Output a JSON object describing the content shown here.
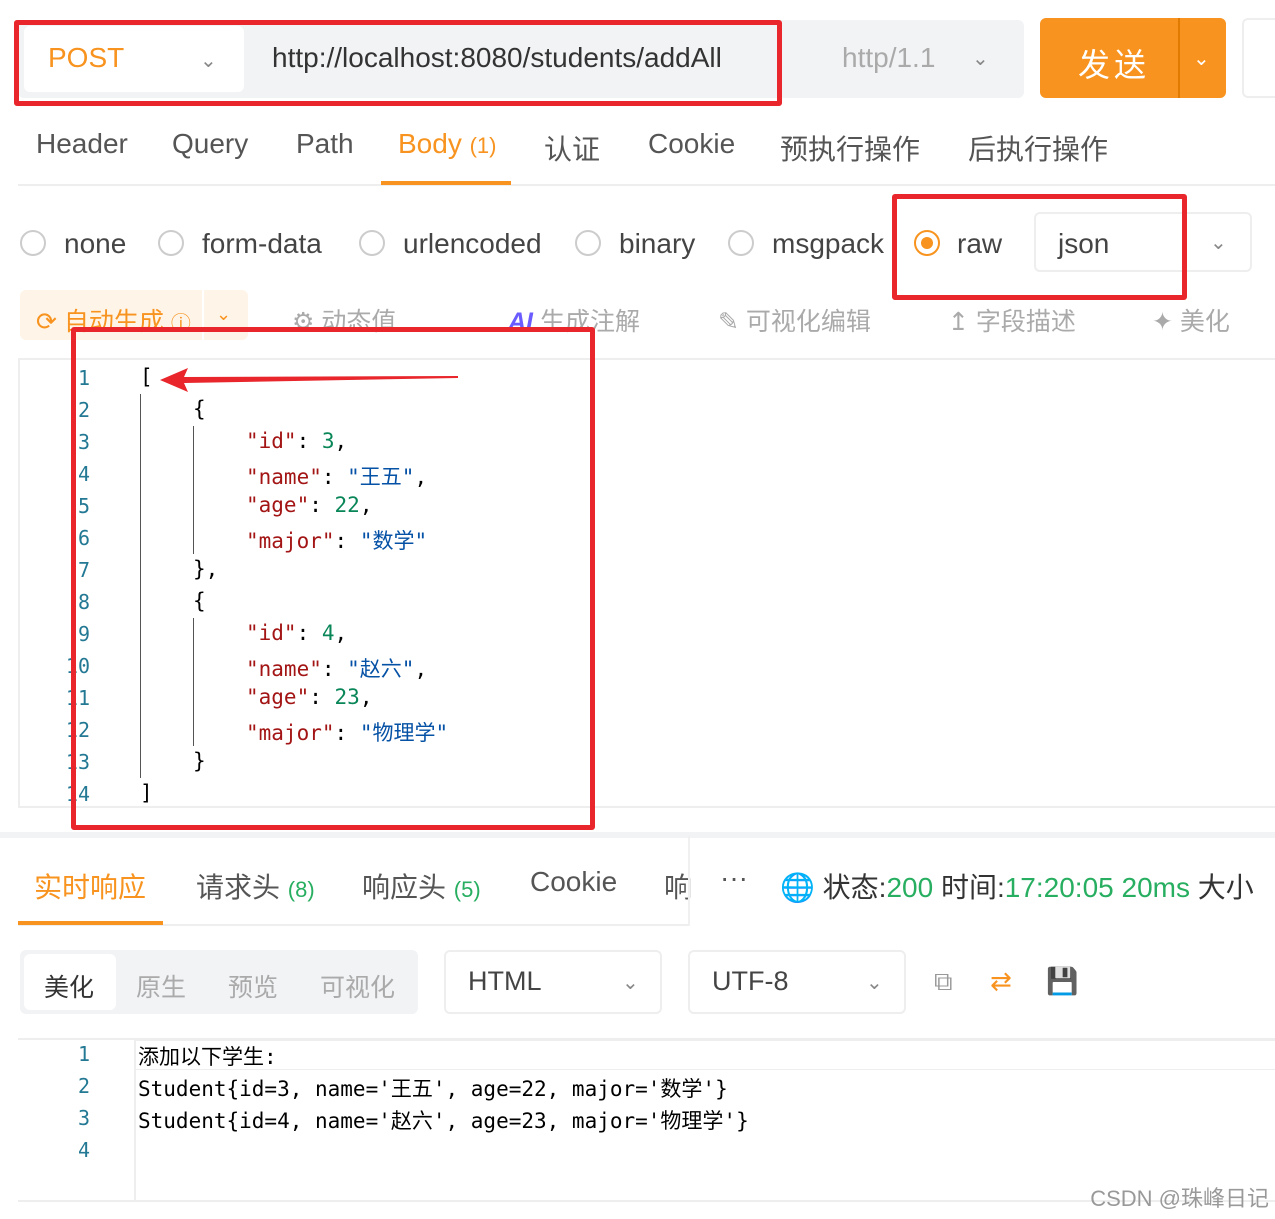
{
  "request": {
    "method": "POST",
    "url": "http://localhost:8080/students/addAll",
    "protocol": "http/1.1",
    "send_label": "发送"
  },
  "tabs": [
    {
      "label": "Header"
    },
    {
      "label": "Query"
    },
    {
      "label": "Path"
    },
    {
      "label": "Body",
      "count": "(1)"
    },
    {
      "label": "认证"
    },
    {
      "label": "Cookie"
    },
    {
      "label": "预执行操作"
    },
    {
      "label": "后执行操作"
    }
  ],
  "body_types": [
    {
      "label": "none"
    },
    {
      "label": "form-data"
    },
    {
      "label": "urlencoded"
    },
    {
      "label": "binary"
    },
    {
      "label": "msgpack"
    },
    {
      "label": "raw"
    }
  ],
  "raw_format": "json",
  "toolbar": {
    "auto_generate": "自动生成",
    "dynamic_value": "动态值",
    "ai_mark": "AI",
    "generate_comments": "生成注解",
    "visual_edit": "可视化编辑",
    "field_desc": "字段描述",
    "beautify": "美化"
  },
  "editor": {
    "line_numbers": [
      "1",
      "2",
      "3",
      "4",
      "5",
      "6",
      "7",
      "8",
      "9",
      "10",
      "11",
      "12",
      "13",
      "14"
    ],
    "lines": [
      {
        "indent": 0,
        "parts": [
          {
            "t": "p",
            "v": "["
          }
        ]
      },
      {
        "indent": 1,
        "parts": [
          {
            "t": "p",
            "v": "{"
          }
        ]
      },
      {
        "indent": 2,
        "parts": [
          {
            "t": "k",
            "v": "\"id\""
          },
          {
            "t": "p",
            "v": ": "
          },
          {
            "t": "n",
            "v": "3"
          },
          {
            "t": "p",
            "v": ","
          }
        ]
      },
      {
        "indent": 2,
        "parts": [
          {
            "t": "k",
            "v": "\"name\""
          },
          {
            "t": "p",
            "v": ": "
          },
          {
            "t": "s",
            "v": "\"王五\""
          },
          {
            "t": "p",
            "v": ","
          }
        ]
      },
      {
        "indent": 2,
        "parts": [
          {
            "t": "k",
            "v": "\"age\""
          },
          {
            "t": "p",
            "v": ": "
          },
          {
            "t": "n",
            "v": "22"
          },
          {
            "t": "p",
            "v": ","
          }
        ]
      },
      {
        "indent": 2,
        "parts": [
          {
            "t": "k",
            "v": "\"major\""
          },
          {
            "t": "p",
            "v": ": "
          },
          {
            "t": "s",
            "v": "\"数学\""
          }
        ]
      },
      {
        "indent": 1,
        "parts": [
          {
            "t": "p",
            "v": "},"
          }
        ]
      },
      {
        "indent": 1,
        "parts": [
          {
            "t": "p",
            "v": "{"
          }
        ]
      },
      {
        "indent": 2,
        "parts": [
          {
            "t": "k",
            "v": "\"id\""
          },
          {
            "t": "p",
            "v": ": "
          },
          {
            "t": "n",
            "v": "4"
          },
          {
            "t": "p",
            "v": ","
          }
        ]
      },
      {
        "indent": 2,
        "parts": [
          {
            "t": "k",
            "v": "\"name\""
          },
          {
            "t": "p",
            "v": ": "
          },
          {
            "t": "s",
            "v": "\"赵六\""
          },
          {
            "t": "p",
            "v": ","
          }
        ]
      },
      {
        "indent": 2,
        "parts": [
          {
            "t": "k",
            "v": "\"age\""
          },
          {
            "t": "p",
            "v": ": "
          },
          {
            "t": "n",
            "v": "23"
          },
          {
            "t": "p",
            "v": ","
          }
        ]
      },
      {
        "indent": 2,
        "parts": [
          {
            "t": "k",
            "v": "\"major\""
          },
          {
            "t": "p",
            "v": ": "
          },
          {
            "t": "s",
            "v": "\"物理学\""
          }
        ]
      },
      {
        "indent": 1,
        "parts": [
          {
            "t": "p",
            "v": "}"
          }
        ]
      },
      {
        "indent": 0,
        "parts": [
          {
            "t": "p",
            "v": "]"
          }
        ]
      }
    ]
  },
  "response_tabs": [
    {
      "label": "实时响应"
    },
    {
      "label": "请求头",
      "count": "(8)"
    },
    {
      "label": "响应头",
      "count": "(5)"
    },
    {
      "label": "Cookie"
    },
    {
      "label": "响"
    }
  ],
  "more": "···",
  "status": {
    "status_label": "状态:",
    "status_value": "200",
    "time_label": "时间:",
    "time_value": "17:20:05",
    "duration": "20ms",
    "size_label": "大小"
  },
  "view_modes": [
    "美化",
    "原生",
    "预览",
    "可视化"
  ],
  "content_type": "HTML",
  "encoding": "UTF-8",
  "response": {
    "line_numbers": [
      "1",
      "2",
      "3",
      "4"
    ],
    "lines": [
      "添加以下学生:",
      "Student{id=3, name='王五', age=22, major='数学'}",
      "Student{id=4, name='赵六', age=23, major='物理学'}",
      ""
    ]
  },
  "watermark": "CSDN @珠峰日记",
  "colors": {
    "accent": "#f7931e",
    "annotation_red": "#e8262b",
    "status_green": "#27ae60"
  }
}
